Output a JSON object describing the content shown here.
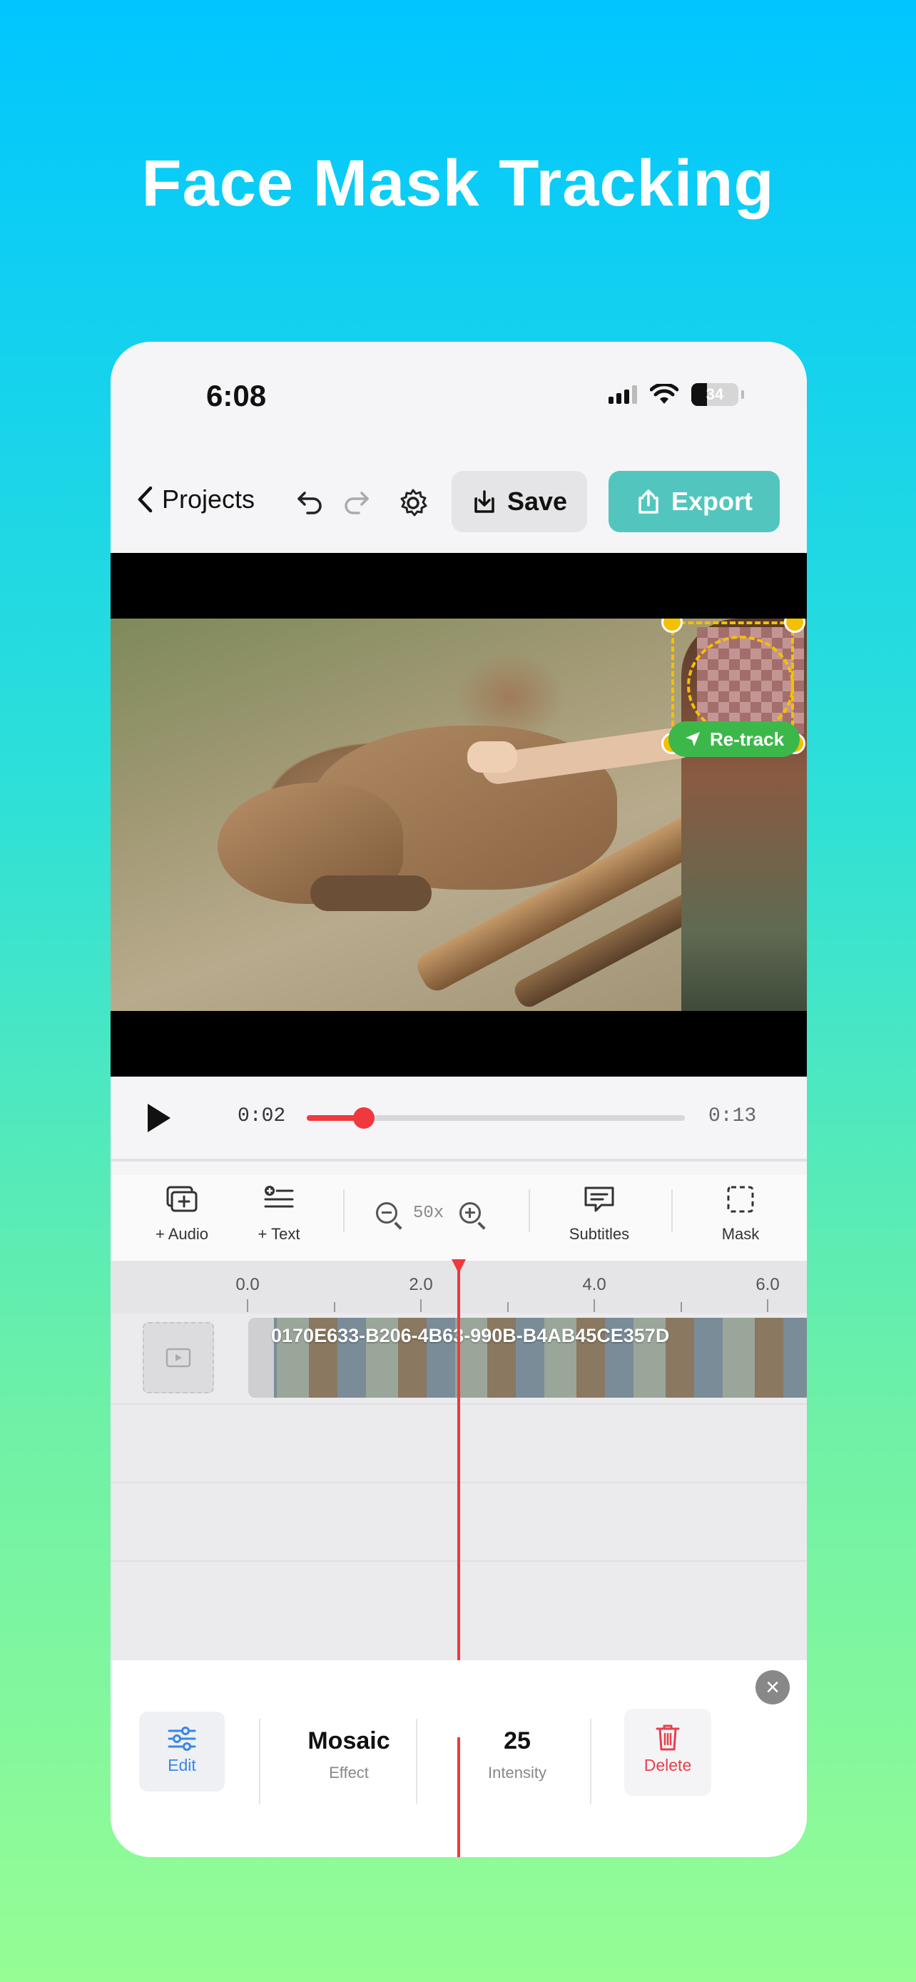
{
  "headline": "Face Mask Tracking",
  "status": {
    "time": "6:08",
    "battery": "34"
  },
  "toolbar": {
    "back_label": "Projects",
    "save_label": "Save",
    "export_label": "Export"
  },
  "video": {
    "retrack_label": "Re-track"
  },
  "playback": {
    "current": "0:02",
    "total": "0:13",
    "progress": 0.15
  },
  "tools": {
    "audio": "+ Audio",
    "text": "+ Text",
    "zoom": "50x",
    "subtitles": "Subtitles",
    "mask": "Mask"
  },
  "timeline": {
    "ticks": [
      "0.0",
      "2.0",
      "4.0",
      "6.0"
    ],
    "clip_name": "0170E633-B206-4B63-990B-B4AB45CE357D"
  },
  "panel": {
    "edit_label": "Edit",
    "effect_value": "Mosaic",
    "effect_label": "Effect",
    "intensity_value": "25",
    "intensity_label": "Intensity",
    "delete_label": "Delete"
  },
  "colors": {
    "accent": "#52c6be",
    "playhead": "#f0383e",
    "track": "#f5c000",
    "retrack": "#3cb84a"
  }
}
